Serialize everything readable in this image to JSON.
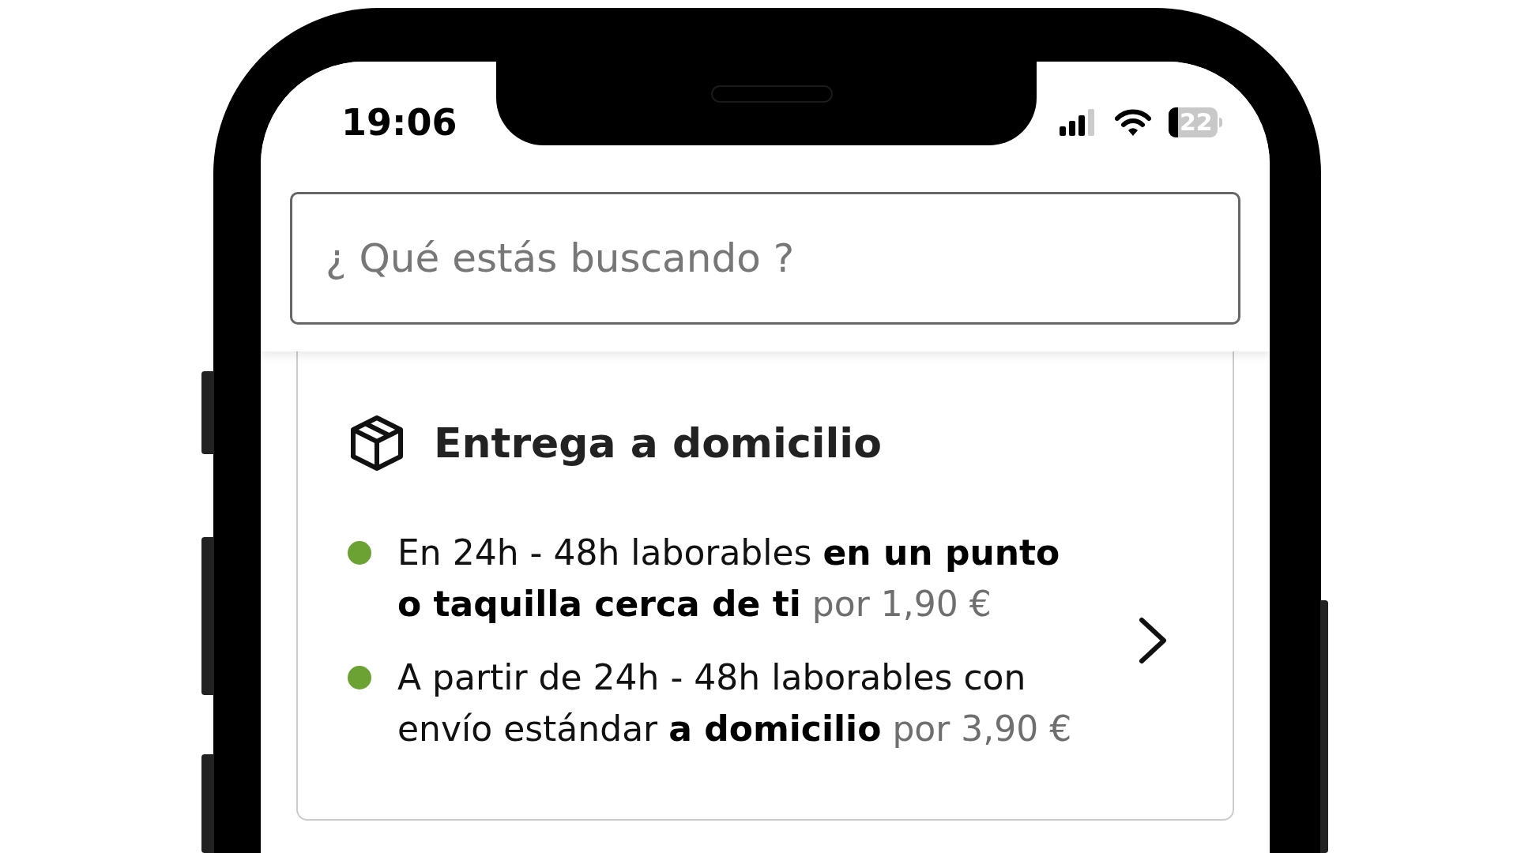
{
  "status_bar": {
    "time": "19:06",
    "battery": "22"
  },
  "search": {
    "placeholder": "¿ Qué estás buscando ?"
  },
  "delivery_card": {
    "title": "Entrega a domicilio",
    "options": [
      {
        "color": "#6ca233",
        "segments": [
          {
            "kind": "normal",
            "text": "En 24h - 48h laborables "
          },
          {
            "kind": "bold",
            "text": "en un punto o taquilla cerca de ti"
          },
          {
            "kind": "muted",
            "text": " por 1,90 €"
          }
        ]
      },
      {
        "color": "#6ca233",
        "segments": [
          {
            "kind": "normal",
            "text": "A partir de 24h - 48h laborables con envío estándar "
          },
          {
            "kind": "bold",
            "text": "a domicilio"
          },
          {
            "kind": "muted",
            "text": " por 3,90 €"
          }
        ]
      }
    ]
  }
}
